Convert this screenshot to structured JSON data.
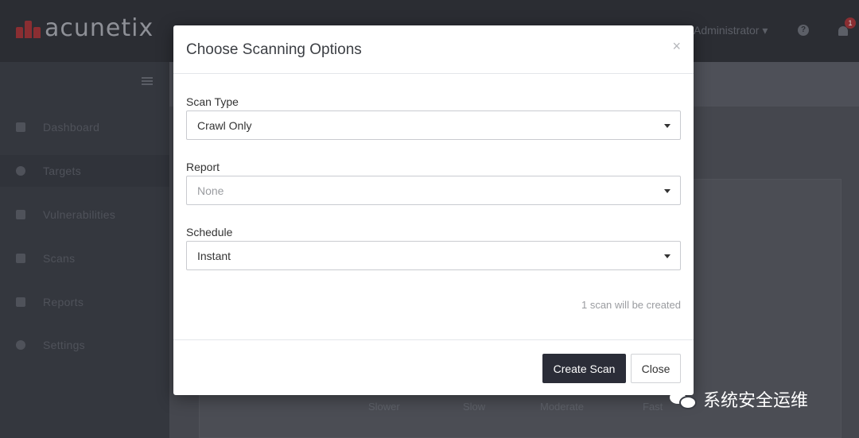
{
  "app": {
    "logo_text": "acunetix",
    "user_menu": "Administrator ▾",
    "notification_count": "1"
  },
  "sidebar": {
    "items": [
      {
        "label": "Dashboard",
        "icon": "dashboard-icon"
      },
      {
        "label": "Targets",
        "icon": "target-icon"
      },
      {
        "label": "Vulnerabilities",
        "icon": "bug-icon"
      },
      {
        "label": "Scans",
        "icon": "chart-icon"
      },
      {
        "label": "Reports",
        "icon": "document-icon"
      },
      {
        "label": "Settings",
        "icon": "gear-icon"
      }
    ]
  },
  "background": {
    "speed_labels": [
      "Slower",
      "Slow",
      "Moderate",
      "Fast"
    ]
  },
  "modal": {
    "title": "Choose Scanning Options",
    "close_glyph": "×",
    "scan_type": {
      "label": "Scan Type",
      "value": "Crawl Only"
    },
    "report": {
      "label": "Report",
      "value": "None"
    },
    "schedule": {
      "label": "Schedule",
      "value": "Instant"
    },
    "scan_count": "1 scan will be created",
    "create_button": "Create Scan",
    "close_button": "Close"
  },
  "watermark": {
    "text": "系统安全运维"
  },
  "colors": {
    "accent": "#8a2e32",
    "primary_button": "#2b2d38",
    "sidebar_bg": "#34373e",
    "topbar_bg": "#2b2d33"
  }
}
